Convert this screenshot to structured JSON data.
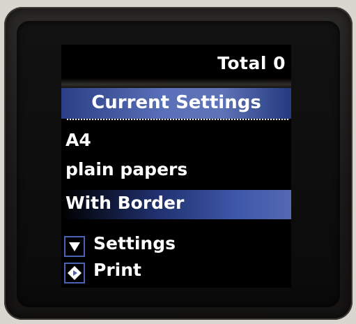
{
  "screen": {
    "total": "Total 0",
    "header": "Current Settings",
    "settings": [
      {
        "label": "A4"
      },
      {
        "label": "plain papers"
      },
      {
        "label": "With Border",
        "selected": true
      }
    ],
    "menu": [
      {
        "label": "Settings",
        "icon": "down-arrow-icon"
      },
      {
        "label": "Print",
        "icon": "start-diamond-icon"
      }
    ],
    "colors": {
      "accent": "#4a63b5",
      "header": "#5a70b8",
      "selected": "#3d56a8"
    }
  }
}
